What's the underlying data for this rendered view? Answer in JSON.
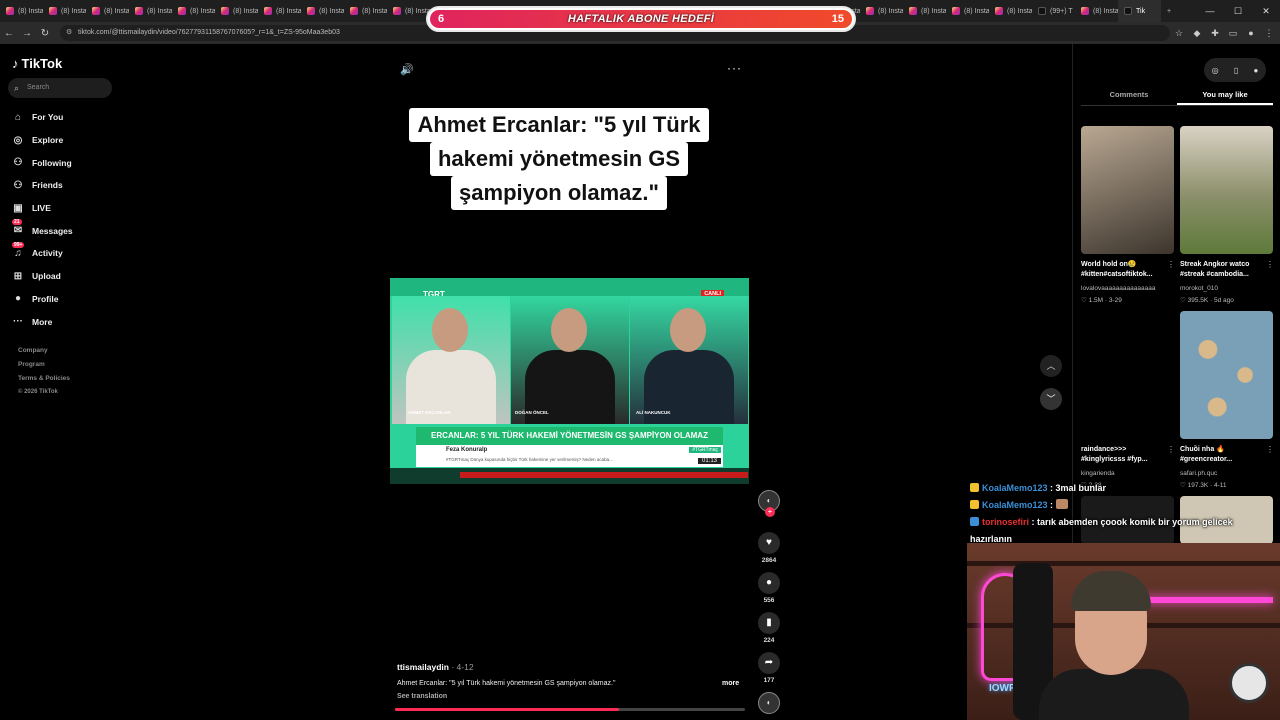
{
  "browser": {
    "tabs": [
      {
        "label": "(8) Insta",
        "type": "instagram"
      },
      {
        "label": "(8) Insta",
        "type": "instagram"
      },
      {
        "label": "(8) Insta",
        "type": "instagram"
      },
      {
        "label": "(8) Insta",
        "type": "instagram"
      },
      {
        "label": "(8) Insta",
        "type": "instagram"
      },
      {
        "label": "(8) Insta",
        "type": "instagram"
      },
      {
        "label": "(8) Insta",
        "type": "instagram"
      },
      {
        "label": "(8) Insta",
        "type": "instagram"
      },
      {
        "label": "(8) Insta",
        "type": "instagram"
      },
      {
        "label": "(8) Insta",
        "type": "instagram"
      },
      {
        "label": "(8) Insta",
        "type": "instagram"
      },
      {
        "label": "(8) Insta",
        "type": "instagram"
      },
      {
        "label": "(8) Insta",
        "type": "instagram"
      },
      {
        "label": "(8) Insta",
        "type": "instagram"
      },
      {
        "label": "(8) Insta",
        "type": "instagram"
      },
      {
        "label": "(8) Insta",
        "type": "instagram"
      },
      {
        "label": "(8) Insta",
        "type": "instagram"
      },
      {
        "label": "(8) Insta",
        "type": "instagram"
      },
      {
        "label": "(8) Insta",
        "type": "instagram"
      },
      {
        "label": "(8) Insta",
        "type": "instagram"
      },
      {
        "label": "(8) Insta",
        "type": "instagram"
      },
      {
        "label": "(8) Insta",
        "type": "instagram"
      },
      {
        "label": "(8) Insta",
        "type": "instagram"
      },
      {
        "label": "(8) Insta",
        "type": "instagram"
      },
      {
        "label": "(99+) T",
        "type": "tiktok"
      },
      {
        "label": "(8) Insta",
        "type": "instagram"
      },
      {
        "label": "Tik",
        "type": "tiktok",
        "active": true
      }
    ],
    "url": "tiktok.com/@ttismailaydin/video/7627793115876707605?_r=1&_t=ZS-95oMaa3eb03"
  },
  "overlay_goal": {
    "title": "HAFTALIK ABONE HEDEFİ",
    "current": "6",
    "target": "15",
    "fill_color": "#e0245e"
  },
  "sidebar": {
    "brand": "TikTok",
    "search_placeholder": "Search",
    "items": [
      {
        "label": "For You",
        "icon": "home-icon",
        "glyph": "⌂"
      },
      {
        "label": "Explore",
        "icon": "compass-icon",
        "glyph": "◎"
      },
      {
        "label": "Following",
        "icon": "person-follow-icon",
        "glyph": "⚇"
      },
      {
        "label": "Friends",
        "icon": "friends-icon",
        "glyph": "⚇"
      },
      {
        "label": "LIVE",
        "icon": "live-icon",
        "glyph": "▣"
      },
      {
        "label": "Messages",
        "icon": "message-icon",
        "glyph": "✉",
        "badge": "21"
      },
      {
        "label": "Activity",
        "icon": "bell-icon",
        "glyph": "♫",
        "badge": "99+"
      },
      {
        "label": "Upload",
        "icon": "upload-icon",
        "glyph": "⊞"
      },
      {
        "label": "Profile",
        "icon": "avatar-icon",
        "glyph": "●"
      },
      {
        "label": "More",
        "icon": "more-icon",
        "glyph": "···"
      }
    ],
    "footer": {
      "company": "Company",
      "program": "Program",
      "terms": "Terms & Policies",
      "copyright": "© 2026 TikTok"
    }
  },
  "video": {
    "caption_lines": [
      "Ahmet Ercanlar: \"5 yıl Türk",
      "hakemi yönetmesin GS",
      "şampiyon olamaz.\""
    ],
    "broadcast": {
      "channel": "TGRT",
      "live_badge": "CANLI",
      "names": [
        "AHMET ERCANLAR",
        "DOĞAN ÖNCEL",
        "ALİ NAKUNCUK"
      ],
      "headline": "ERCANLAR: 5 YIL TÜRK HAKEMİ YÖNETMESİN GS ŞAMPİYON OLAMAZ",
      "tweet_user": "Feza Konuralp",
      "tweet_text": "#TGRTmaç Dünya kupasında hiçbir Türk hakemine yer verilmemiş? Neden acaba...",
      "tag": "#TGRTmaç",
      "time": "01:13"
    },
    "author": "ttismailaydin",
    "date": "4-12",
    "description": "Ahmet Ercanlar: \"5 yıl Türk hakemi yönetmesin GS şampiyon olamaz.\"",
    "see_translation": "See translation",
    "more": "more",
    "progress_fraction": 0.64,
    "actions": {
      "likes": "2864",
      "comments": "556",
      "saves": "224",
      "shares": "177"
    }
  },
  "right_panel": {
    "tabs": [
      "Comments",
      "You may like"
    ],
    "active_tab": "You may like",
    "recs": [
      {
        "title": "World hold on😢 #kitten#catsoftiktok...",
        "author": "lovalovaaaaaaaaaaaaaaa",
        "stats": "♡ 1.5M · 3-29"
      },
      {
        "title": "Streak Angkor watco #streak #cambodia...",
        "author": "morokot_010",
        "stats": "♡ 395.5K · 5d ago"
      },
      {
        "title": "raindance>>> #kinglyricsss #fyp...",
        "author": "kingarienda",
        "stats": "♡ 2-28"
      },
      {
        "title": "Chuồi nha 🔥 #greencreator...",
        "author": "safari.ph.quc",
        "stats": "♡ 197.3K · 4-11"
      }
    ]
  },
  "chat": [
    {
      "user": "KoalaMemo123",
      "message": ": 3mal bunlar",
      "color": "#3a8fd6"
    },
    {
      "user": "KoalaMemo123",
      "message": ":",
      "color": "#3a8fd6"
    },
    {
      "user": "torinosefiri",
      "message": ": tarık abemden çoook komik bir yorum gelicek hazırlanın",
      "color": "#e63131"
    }
  ],
  "webcam": {
    "neon_text": "IOWF"
  }
}
